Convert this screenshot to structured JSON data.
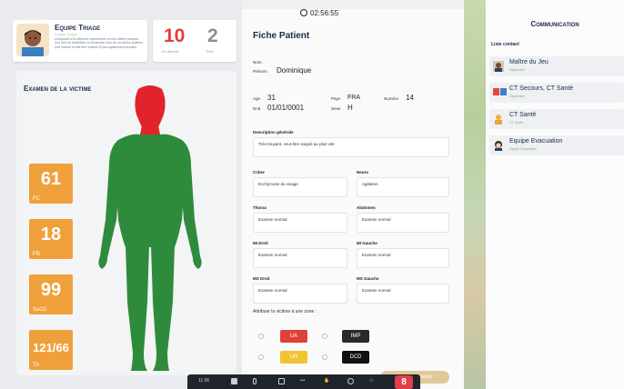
{
  "team": {
    "name": "Equipe Triage",
    "subtitle": "Equipe Triage",
    "description": "Composée d'un Médecin expérimenté et d'un officier pompier. Son rôle est d'identifier et d'examiner tous les nombreux patients. Doit évaluer et doit être réalisée le plus rapidement possible."
  },
  "counters": {
    "waiting_value": "10",
    "waiting_label": "En attente",
    "sorted_value": "2",
    "sorted_label": "Triés"
  },
  "exam": {
    "title": "Examen de la victime",
    "vitals": [
      {
        "value": "61",
        "label": "FC"
      },
      {
        "value": "18",
        "label": "FR"
      },
      {
        "value": "99",
        "label": "SaO2"
      },
      {
        "value": "121/66",
        "label": "TA"
      }
    ],
    "colors": {
      "head": "#e0242a",
      "body": "#2e8b3c",
      "vital_bg": "#f0a03a"
    }
  },
  "timer": "02:56:55",
  "sheet": {
    "title": "Fiche Patient",
    "nom_label": "Nom",
    "prenom_label": "Prénom",
    "prenom": "Dominique",
    "age_label": "Age",
    "age": "31",
    "pays_label": "Pays",
    "pays": "FRA",
    "numero_label": "Numéro",
    "numero": "14",
    "ddn_label": "Dnd",
    "ddn": "01/01/0001",
    "sexe_label": "Sexe",
    "sexe": "H",
    "description_label": "Description générale",
    "description": "Très bruyant, veut être soigné au plus vite",
    "fields": [
      {
        "label": "Crâne",
        "value": "Ecchymose du visage"
      },
      {
        "label": "Neuro",
        "value": "Agitation"
      },
      {
        "label": "Thorax",
        "value": "Examen normal"
      },
      {
        "label": "Abdomen",
        "value": "Examen normal"
      },
      {
        "label": "MI Droit",
        "value": "Examen normal"
      },
      {
        "label": "MI Gauche",
        "value": "Examen normal"
      },
      {
        "label": "MS Droit",
        "value": "Examen normal"
      },
      {
        "label": "MS Gauche",
        "value": "Examen normal"
      }
    ],
    "zone_label": "Attribuer la victime à une zone :",
    "zones": [
      {
        "label": "UA",
        "color": "#e0403a"
      },
      {
        "label": "IMP",
        "color": "#2a2a2a"
      },
      {
        "label": "UR",
        "color": "#f2c230"
      },
      {
        "label": "DCD",
        "color": "#111111"
      }
    ],
    "validate": "Valider"
  },
  "toolbar": {
    "time": "11:06",
    "end_label": "8"
  },
  "communication": {
    "title": "Communication",
    "list_title": "Liste contact",
    "contacts": [
      {
        "name": "Maître du Jeu",
        "status": "Disponible",
        "icon": "person-icon"
      },
      {
        "name": "CT Secours, CT Santé",
        "status": "Disponible",
        "icon": "group-icon"
      },
      {
        "name": "CT Santé",
        "status": "CT Santé",
        "icon": "medic-icon"
      },
      {
        "name": "Equipe Evacuation",
        "status": "Equipe Evacuation",
        "icon": "evacuation-icon"
      }
    ]
  }
}
